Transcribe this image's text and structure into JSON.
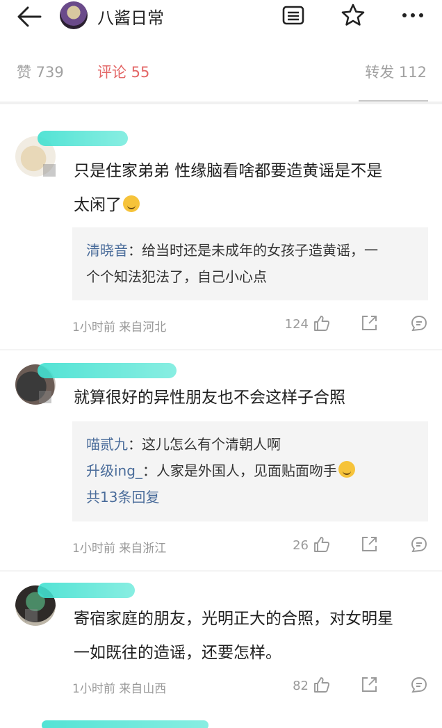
{
  "header": {
    "title": "八酱日常"
  },
  "tabs": {
    "likes": "赞 739",
    "comments": "评论 55",
    "reposts": "转发 112"
  },
  "colors": {
    "accent": "#e36666",
    "link": "#4a6c9a",
    "name_mask": "#40e0d0"
  },
  "comments": [
    {
      "text_line1": "只是住家弟弟 性缘脑看啥都要造黄谣是不是",
      "text_line2": "太闲了",
      "emoji": "upside-down-face",
      "replies": [
        {
          "name": "清晓音",
          "text": "：给当时还是未成年的女孩子造黄谣，一"
        },
        {
          "name": "",
          "text": "个个知法犯法了，自己小心点"
        }
      ],
      "time": "1小时前  来自河北",
      "likes": "124"
    },
    {
      "text_line1": "就算很好的异性朋友也不会这样子合照",
      "replies": [
        {
          "name": "喵贰九",
          "text": "：这儿怎么有个清朝人啊"
        },
        {
          "name": "升级ing_",
          "text": "：人家是外国人，见面贴面吻手"
        }
      ],
      "more_replies": "共13条回复",
      "time": "1小时前  来自浙江",
      "likes": "26"
    },
    {
      "text_line1": "寄宿家庭的朋友，光明正大的合照，对女明星",
      "text_line2": "一如既往的造谣，还要怎样。",
      "time": "1小时前  来自山西",
      "likes": "82"
    }
  ]
}
